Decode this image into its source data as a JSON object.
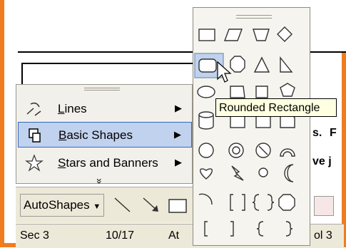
{
  "menu": {
    "items": [
      {
        "label": "Lines",
        "icon": "lines-icon"
      },
      {
        "label": "Basic Shapes",
        "icon": "basic-shapes-icon",
        "selected": true
      },
      {
        "label": "Stars and Banners",
        "icon": "stars-banners-icon"
      }
    ],
    "expand_symbol": "»"
  },
  "toolbar": {
    "autoshapes_label": "AutoShapes"
  },
  "status": {
    "section": "Sec 3",
    "page": "10/17",
    "at": "At",
    "col": "ol 3"
  },
  "tooltip": {
    "text": "Rounded Rectangle"
  },
  "doc_fragments": {
    "frag1": "s.",
    "frag2": "F",
    "frag3": "ve j"
  },
  "palette": {
    "hovered_shape": "rounded-rectangle"
  },
  "colors": {
    "border": "#f07c1e",
    "selected_bg": "#c1d2ee",
    "tooltip_bg": "#ffffe1"
  }
}
